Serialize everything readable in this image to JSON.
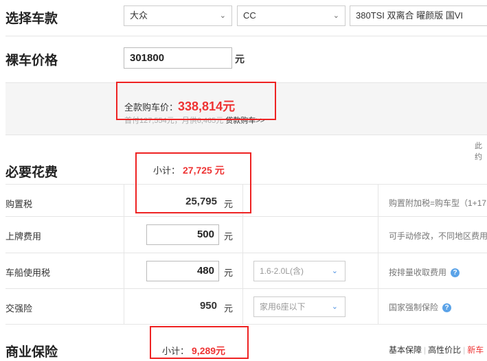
{
  "select_model": {
    "title": "选择车款",
    "brand": "大众",
    "series": "CC",
    "version": "380TSI 双离合 曜颜版 国VI"
  },
  "bare_price": {
    "title": "裸车价格",
    "value": "301800",
    "unit": "元"
  },
  "summary": {
    "full_price_label": "全款购车价：",
    "full_price_value": "338,814元",
    "loan_text": "首付127,554元，月供6,465元",
    "loan_link": "贷款购车>>",
    "right_cut": "此约"
  },
  "required_fees": {
    "title": "必要花费",
    "subtotal_label": "小计：",
    "subtotal_value": "27,725 元",
    "rows": [
      {
        "name": "购置税",
        "value": "25,795",
        "unit": "元",
        "note": "购置附加税=购车型（1+17"
      },
      {
        "name": "上牌费用",
        "value": "500",
        "unit": "元",
        "note": "可手动修改，不同地区费用"
      },
      {
        "name": "车船使用税",
        "value": "480",
        "unit": "元",
        "option": "1.6-2.0L(含)",
        "note": "按排量收取费用"
      },
      {
        "name": "交强险",
        "value": "950",
        "unit": "元",
        "option": "家用6座以下",
        "note": "国家强制保险"
      }
    ]
  },
  "commercial": {
    "title": "商业保险",
    "subtotal_label": "小计：",
    "subtotal_value": "9,289元",
    "links": [
      "基本保障",
      "高性价比",
      "新车"
    ]
  },
  "colors": {
    "accent_red": "#e22",
    "help_blue": "#5ba3e8"
  }
}
